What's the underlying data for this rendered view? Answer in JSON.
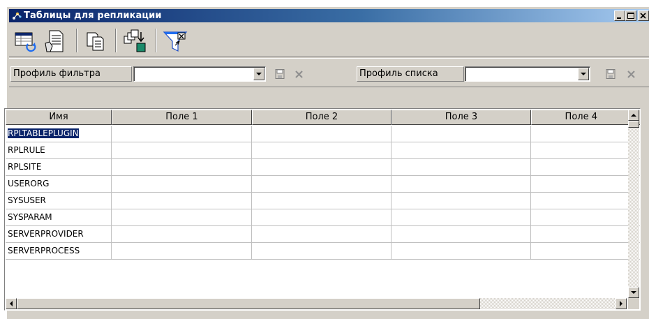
{
  "window": {
    "title": "Таблицы для репликации",
    "buttons": [
      "minimize",
      "maximize",
      "close"
    ]
  },
  "toolbar": {
    "tools": [
      {
        "name": "refresh-table-icon"
      },
      {
        "name": "edit-document-icon"
      },
      {
        "name": "copy-icon"
      },
      {
        "name": "export-icon"
      },
      {
        "name": "filter-clear-icon"
      }
    ]
  },
  "filter": {
    "filter_profile_label": "Профиль фильтра",
    "filter_profile_value": "",
    "list_profile_label": "Профиль списка",
    "list_profile_value": ""
  },
  "table": {
    "columns": [
      "Имя",
      "Поле 1",
      "Поле 2",
      "Поле 3",
      "Поле 4"
    ],
    "rows": [
      [
        "RPLTABLEPLUGIN",
        "",
        "",
        "",
        ""
      ],
      [
        "RPLRULE",
        "",
        "",
        "",
        ""
      ],
      [
        "RPLSITE",
        "",
        "",
        "",
        ""
      ],
      [
        "USERORG",
        "",
        "",
        "",
        ""
      ],
      [
        "SYSUSER",
        "",
        "",
        "",
        ""
      ],
      [
        "SYSPARAM",
        "",
        "",
        "",
        ""
      ],
      [
        "SERVERPROVIDER",
        "",
        "",
        "",
        ""
      ],
      [
        "SERVERPROCESS",
        "",
        "",
        "",
        ""
      ]
    ],
    "selected_row": 0
  },
  "colors": {
    "title_gradient_start": "#0a246a",
    "title_gradient_end": "#a6caf0",
    "face": "#d4d0c8",
    "selection": "#0a246a"
  }
}
